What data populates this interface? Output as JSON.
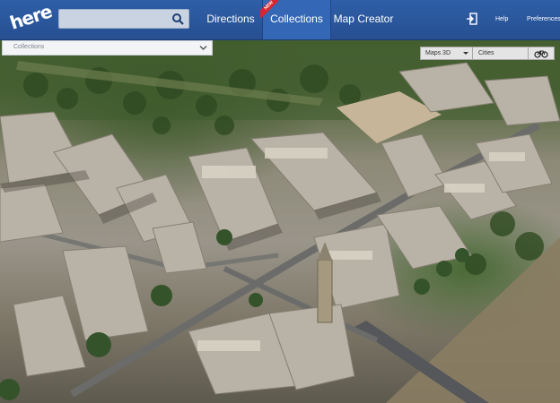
{
  "app": {
    "logo_text": "here"
  },
  "search": {
    "placeholder": "",
    "value": ""
  },
  "nav": {
    "directions": "Directions",
    "collections": "Collections",
    "collections_badge": "NEW",
    "map_creator": "Map Creator",
    "help": "Help",
    "preferences": "Preferences"
  },
  "collections_panel": {
    "label": "Collections"
  },
  "map_controls": {
    "mode": "Maps 3D",
    "layer": "Cities"
  },
  "icons": {
    "search": "search-icon",
    "sign_in": "sign-in-icon",
    "chevron": "chevron-down-icon",
    "bike": "bicycle-icon",
    "mode_arrow": "caret-down-icon"
  },
  "colors": {
    "topbar": "#2f5fa8",
    "active_tab": "#3468b6",
    "badge": "#d8262f"
  }
}
